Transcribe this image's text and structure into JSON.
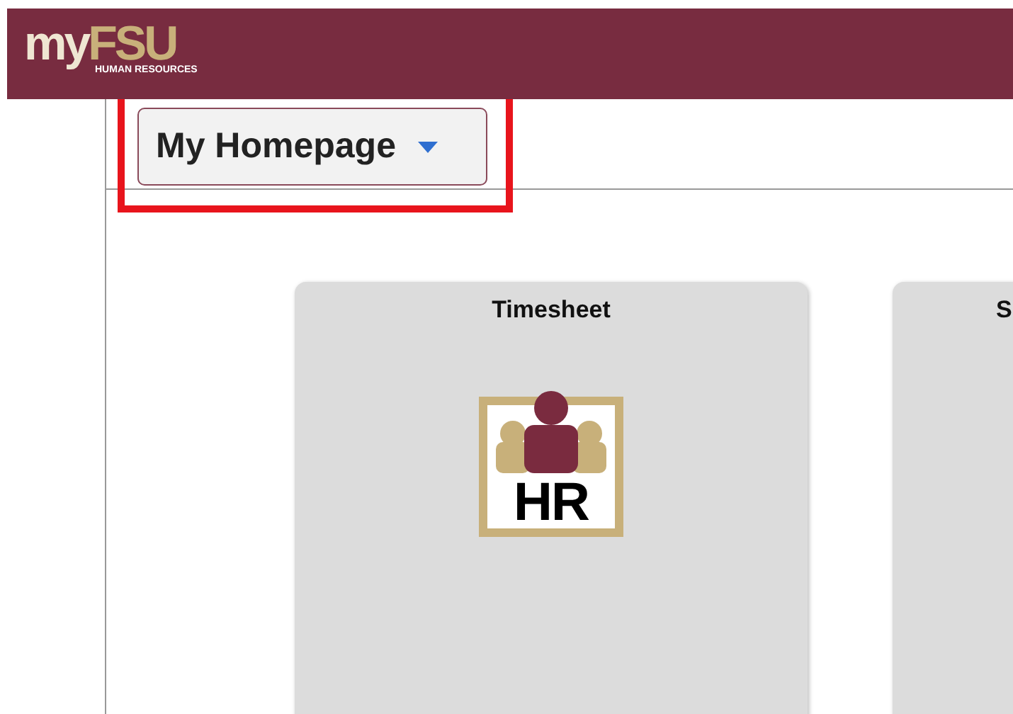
{
  "header": {
    "logo_prefix": "my",
    "logo_main": "FSU",
    "logo_subtitle": "HUMAN RESOURCES"
  },
  "page_selector": {
    "label": "My Homepage",
    "highlighted": true
  },
  "tiles": [
    {
      "title": "Timesheet",
      "kind": "logo",
      "icon_text": "HR"
    },
    {
      "title": "S",
      "kind": "plain"
    }
  ]
}
